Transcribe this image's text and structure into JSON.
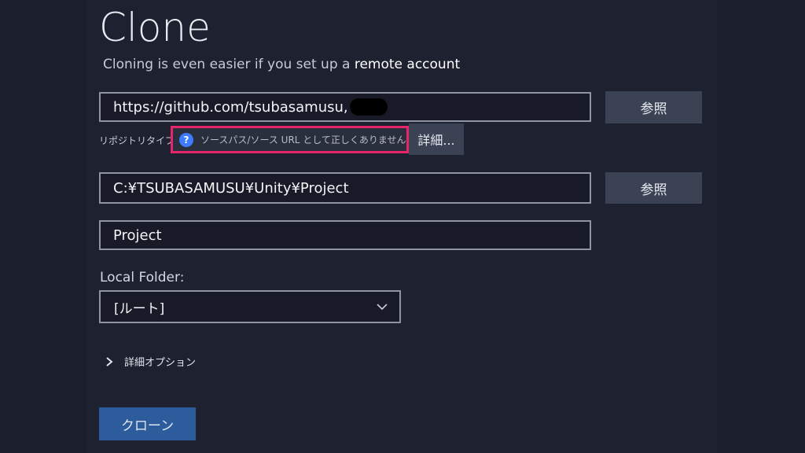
{
  "header": {
    "title": "Clone",
    "subtitle_prefix": "Cloning is even easier if you set up a ",
    "subtitle_link": "remote account"
  },
  "source": {
    "url_value": "https://github.com/tsubasamusu,",
    "browse_label": "参照",
    "repo_type_label": "リポジトリタイプ",
    "error_icon": "question-icon",
    "error_message": "ソースパス/ソース URL として正しくありません",
    "details_label": "詳細..."
  },
  "destination": {
    "path_value": "C:¥TSUBASAMUSU¥Unity¥Project",
    "browse_label": "参照"
  },
  "name": {
    "value": "Project"
  },
  "local_folder": {
    "label": "Local Folder:",
    "selected": "[ルート]"
  },
  "advanced": {
    "label": "詳細オプション"
  },
  "actions": {
    "clone_label": "クローン"
  },
  "colors": {
    "background": "#1e2230",
    "error_border": "#e8246a",
    "info_icon": "#3d7bff",
    "primary_button": "#2c5c9c"
  }
}
